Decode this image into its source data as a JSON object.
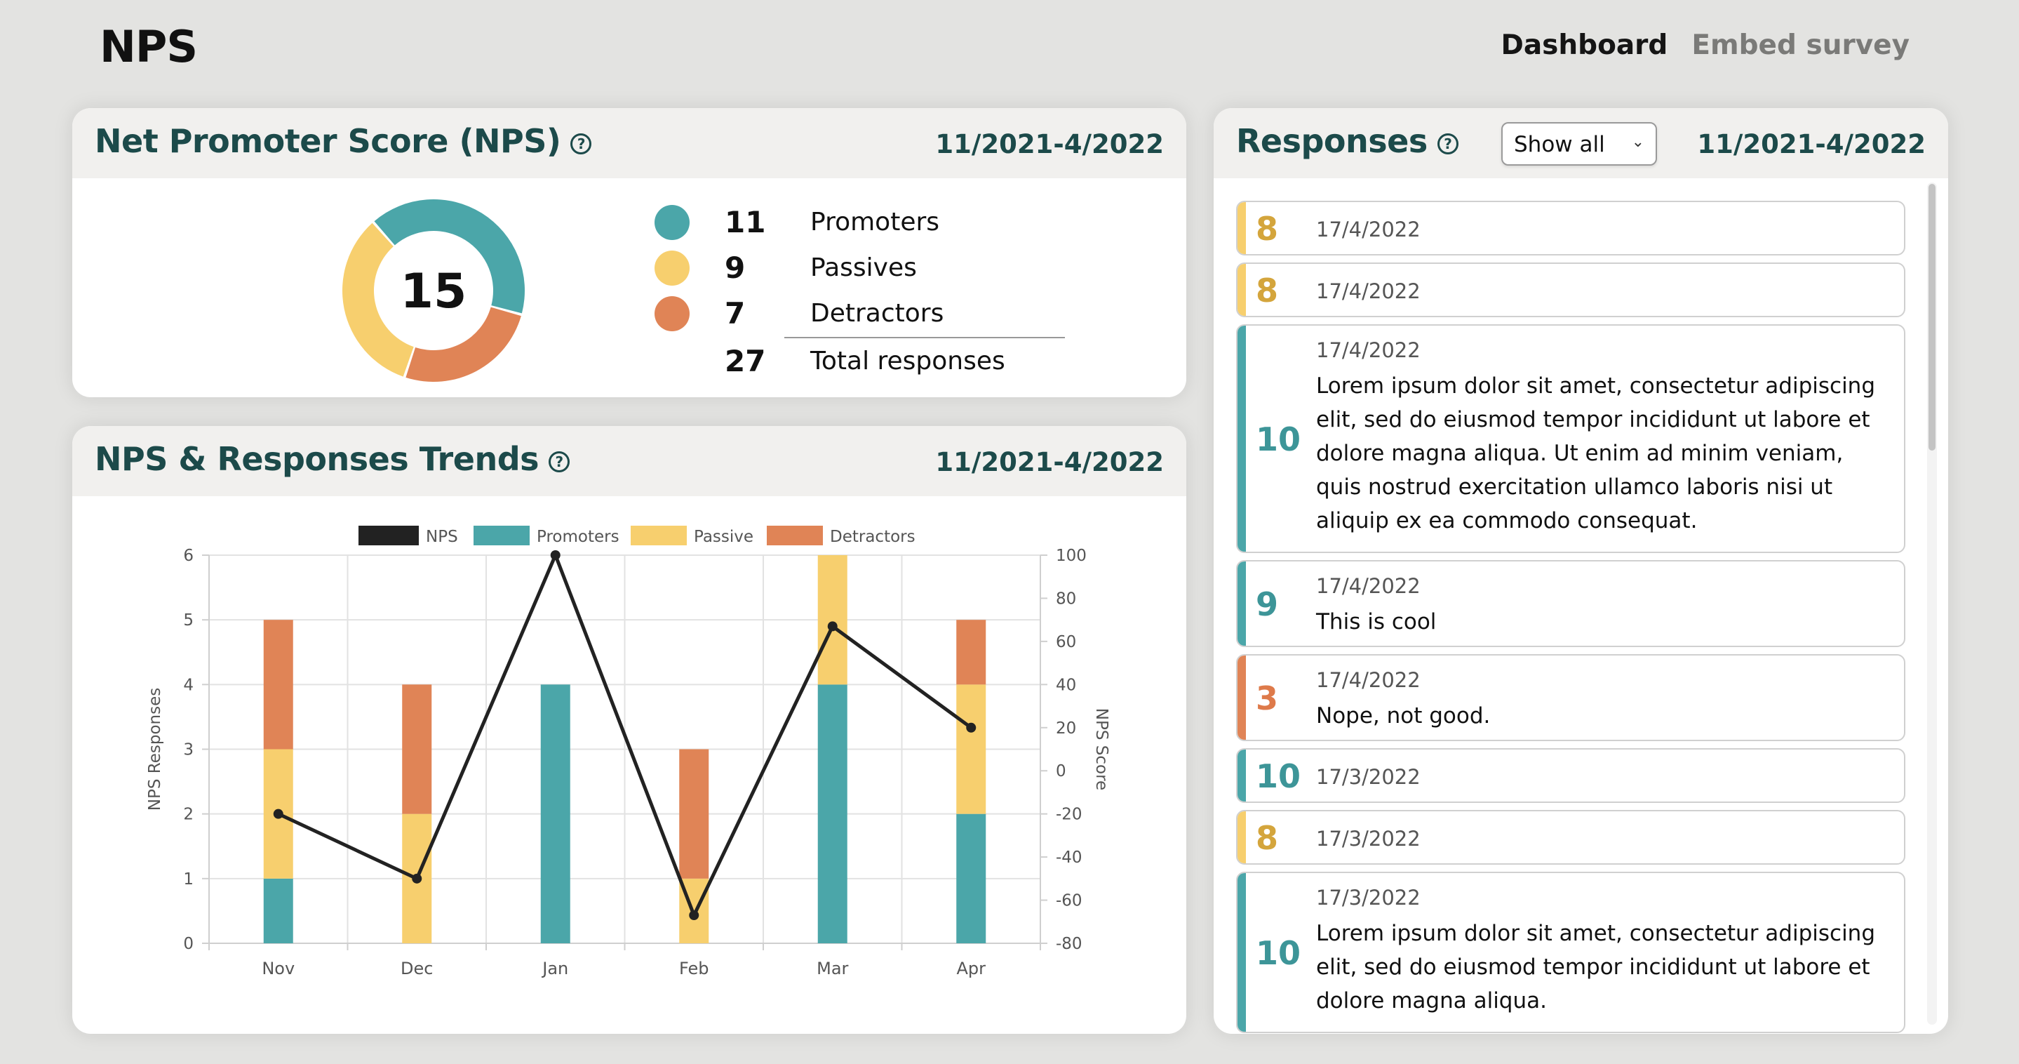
{
  "app": {
    "title": "NPS"
  },
  "nav": {
    "items": [
      {
        "label": "Dashboard"
      },
      {
        "label": "Embed survey"
      }
    ]
  },
  "colors": {
    "promoters": "#4ba6a9",
    "passives": "#f7cf6e",
    "detractors": "#e08456",
    "nps_line": "#222222",
    "heading": "#1c4a4a"
  },
  "nps_card": {
    "title": "Net Promoter Score (NPS)",
    "help_icon": "help-circle-icon",
    "help_glyph": "?",
    "date_range": "11/2021-4/2022",
    "score": "15",
    "legend": [
      {
        "count": "11",
        "label": "Promoters",
        "color": "#4ba6a9"
      },
      {
        "count": "9",
        "label": "Passives",
        "color": "#f7cf6e"
      },
      {
        "count": "7",
        "label": "Detractors",
        "color": "#e08456"
      }
    ],
    "total": {
      "count": "27",
      "label": "Total responses"
    }
  },
  "trends_card": {
    "title": "NPS & Responses Trends",
    "help_icon": "help-circle-icon",
    "help_glyph": "?",
    "date_range": "11/2021-4/2022"
  },
  "chart_data": {
    "type": "bar",
    "categories": [
      "Nov",
      "Dec",
      "Jan",
      "Feb",
      "Mar",
      "Apr"
    ],
    "series": [
      {
        "name": "Promoters",
        "values": [
          1,
          0,
          4,
          0,
          4,
          2
        ],
        "color": "#4ba6a9"
      },
      {
        "name": "Passive",
        "values": [
          2,
          2,
          0,
          1,
          2,
          2
        ],
        "color": "#f7cf6e"
      },
      {
        "name": "Detractors",
        "values": [
          2,
          2,
          0,
          2,
          0,
          1
        ],
        "color": "#e08456"
      }
    ],
    "line": {
      "name": "NPS",
      "values": [
        -20,
        -50,
        100,
        -67,
        67,
        20
      ],
      "color": "#222222",
      "axis": "right"
    },
    "legend_order": [
      "NPS",
      "Promoters",
      "Passive",
      "Detractors"
    ],
    "stacked": true,
    "ylabel": "NPS Responses",
    "y2label": "NPS Score",
    "ylim": [
      0,
      6
    ],
    "y2lim": [
      -80,
      100
    ],
    "yticks": [
      "0",
      "1",
      "2",
      "3",
      "4",
      "5",
      "6"
    ],
    "y2ticks": [
      "-80",
      "-60",
      "-40",
      "-20",
      "0",
      "20",
      "40",
      "60",
      "80",
      "100"
    ],
    "grid": true,
    "legend_position": "top"
  },
  "responses_card": {
    "title": "Responses",
    "help_icon": "help-circle-icon",
    "help_glyph": "?",
    "filter": {
      "selected": "Show all"
    },
    "date_range": "11/2021-4/2022",
    "items": [
      {
        "score": "8",
        "date": "17/4/2022",
        "text": "",
        "color": "#f7cf6e",
        "score_color": "#d4a53c"
      },
      {
        "score": "8",
        "date": "17/4/2022",
        "text": "",
        "color": "#f7cf6e",
        "score_color": "#d4a53c"
      },
      {
        "score": "10",
        "date": "17/4/2022",
        "text": "Lorem ipsum dolor sit amet, consectetur adipiscing elit, sed do eiusmod tempor incididunt ut labore et dolore magna aliqua. Ut enim ad minim veniam, quis nostrud exercitation ullamco laboris nisi ut aliquip ex ea commodo consequat.",
        "color": "#4ba6a9",
        "score_color": "#3d9598"
      },
      {
        "score": "9",
        "date": "17/4/2022",
        "text": "This is cool",
        "color": "#4ba6a9",
        "score_color": "#3d9598"
      },
      {
        "score": "3",
        "date": "17/4/2022",
        "text": "Nope, not good.",
        "color": "#e08456",
        "score_color": "#de7a4a"
      },
      {
        "score": "10",
        "date": "17/3/2022",
        "text": "",
        "color": "#4ba6a9",
        "score_color": "#3d9598"
      },
      {
        "score": "8",
        "date": "17/3/2022",
        "text": "",
        "color": "#f7cf6e",
        "score_color": "#d4a53c"
      },
      {
        "score": "10",
        "date": "17/3/2022",
        "text": "Lorem ipsum dolor sit amet, consectetur adipiscing elit, sed do eiusmod tempor incididunt ut labore et dolore magna aliqua.",
        "color": "#4ba6a9",
        "score_color": "#3d9598"
      }
    ]
  }
}
